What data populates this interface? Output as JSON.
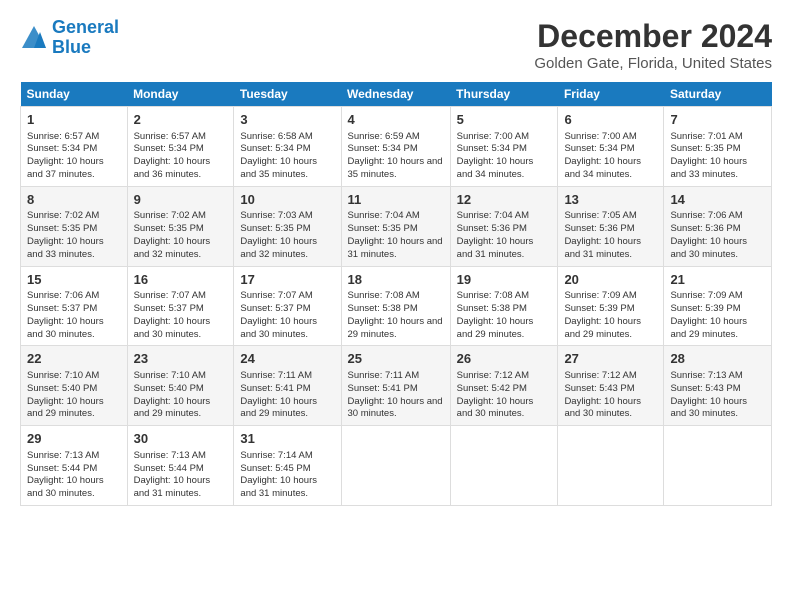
{
  "logo": {
    "line1": "General",
    "line2": "Blue"
  },
  "title": "December 2024",
  "subtitle": "Golden Gate, Florida, United States",
  "days_of_week": [
    "Sunday",
    "Monday",
    "Tuesday",
    "Wednesday",
    "Thursday",
    "Friday",
    "Saturday"
  ],
  "weeks": [
    [
      {
        "day": "1",
        "sunrise": "Sunrise: 6:57 AM",
        "sunset": "Sunset: 5:34 PM",
        "daylight": "Daylight: 10 hours and 37 minutes."
      },
      {
        "day": "2",
        "sunrise": "Sunrise: 6:57 AM",
        "sunset": "Sunset: 5:34 PM",
        "daylight": "Daylight: 10 hours and 36 minutes."
      },
      {
        "day": "3",
        "sunrise": "Sunrise: 6:58 AM",
        "sunset": "Sunset: 5:34 PM",
        "daylight": "Daylight: 10 hours and 35 minutes."
      },
      {
        "day": "4",
        "sunrise": "Sunrise: 6:59 AM",
        "sunset": "Sunset: 5:34 PM",
        "daylight": "Daylight: 10 hours and 35 minutes."
      },
      {
        "day": "5",
        "sunrise": "Sunrise: 7:00 AM",
        "sunset": "Sunset: 5:34 PM",
        "daylight": "Daylight: 10 hours and 34 minutes."
      },
      {
        "day": "6",
        "sunrise": "Sunrise: 7:00 AM",
        "sunset": "Sunset: 5:34 PM",
        "daylight": "Daylight: 10 hours and 34 minutes."
      },
      {
        "day": "7",
        "sunrise": "Sunrise: 7:01 AM",
        "sunset": "Sunset: 5:35 PM",
        "daylight": "Daylight: 10 hours and 33 minutes."
      }
    ],
    [
      {
        "day": "8",
        "sunrise": "Sunrise: 7:02 AM",
        "sunset": "Sunset: 5:35 PM",
        "daylight": "Daylight: 10 hours and 33 minutes."
      },
      {
        "day": "9",
        "sunrise": "Sunrise: 7:02 AM",
        "sunset": "Sunset: 5:35 PM",
        "daylight": "Daylight: 10 hours and 32 minutes."
      },
      {
        "day": "10",
        "sunrise": "Sunrise: 7:03 AM",
        "sunset": "Sunset: 5:35 PM",
        "daylight": "Daylight: 10 hours and 32 minutes."
      },
      {
        "day": "11",
        "sunrise": "Sunrise: 7:04 AM",
        "sunset": "Sunset: 5:35 PM",
        "daylight": "Daylight: 10 hours and 31 minutes."
      },
      {
        "day": "12",
        "sunrise": "Sunrise: 7:04 AM",
        "sunset": "Sunset: 5:36 PM",
        "daylight": "Daylight: 10 hours and 31 minutes."
      },
      {
        "day": "13",
        "sunrise": "Sunrise: 7:05 AM",
        "sunset": "Sunset: 5:36 PM",
        "daylight": "Daylight: 10 hours and 31 minutes."
      },
      {
        "day": "14",
        "sunrise": "Sunrise: 7:06 AM",
        "sunset": "Sunset: 5:36 PM",
        "daylight": "Daylight: 10 hours and 30 minutes."
      }
    ],
    [
      {
        "day": "15",
        "sunrise": "Sunrise: 7:06 AM",
        "sunset": "Sunset: 5:37 PM",
        "daylight": "Daylight: 10 hours and 30 minutes."
      },
      {
        "day": "16",
        "sunrise": "Sunrise: 7:07 AM",
        "sunset": "Sunset: 5:37 PM",
        "daylight": "Daylight: 10 hours and 30 minutes."
      },
      {
        "day": "17",
        "sunrise": "Sunrise: 7:07 AM",
        "sunset": "Sunset: 5:37 PM",
        "daylight": "Daylight: 10 hours and 30 minutes."
      },
      {
        "day": "18",
        "sunrise": "Sunrise: 7:08 AM",
        "sunset": "Sunset: 5:38 PM",
        "daylight": "Daylight: 10 hours and 29 minutes."
      },
      {
        "day": "19",
        "sunrise": "Sunrise: 7:08 AM",
        "sunset": "Sunset: 5:38 PM",
        "daylight": "Daylight: 10 hours and 29 minutes."
      },
      {
        "day": "20",
        "sunrise": "Sunrise: 7:09 AM",
        "sunset": "Sunset: 5:39 PM",
        "daylight": "Daylight: 10 hours and 29 minutes."
      },
      {
        "day": "21",
        "sunrise": "Sunrise: 7:09 AM",
        "sunset": "Sunset: 5:39 PM",
        "daylight": "Daylight: 10 hours and 29 minutes."
      }
    ],
    [
      {
        "day": "22",
        "sunrise": "Sunrise: 7:10 AM",
        "sunset": "Sunset: 5:40 PM",
        "daylight": "Daylight: 10 hours and 29 minutes."
      },
      {
        "day": "23",
        "sunrise": "Sunrise: 7:10 AM",
        "sunset": "Sunset: 5:40 PM",
        "daylight": "Daylight: 10 hours and 29 minutes."
      },
      {
        "day": "24",
        "sunrise": "Sunrise: 7:11 AM",
        "sunset": "Sunset: 5:41 PM",
        "daylight": "Daylight: 10 hours and 29 minutes."
      },
      {
        "day": "25",
        "sunrise": "Sunrise: 7:11 AM",
        "sunset": "Sunset: 5:41 PM",
        "daylight": "Daylight: 10 hours and 30 minutes."
      },
      {
        "day": "26",
        "sunrise": "Sunrise: 7:12 AM",
        "sunset": "Sunset: 5:42 PM",
        "daylight": "Daylight: 10 hours and 30 minutes."
      },
      {
        "day": "27",
        "sunrise": "Sunrise: 7:12 AM",
        "sunset": "Sunset: 5:43 PM",
        "daylight": "Daylight: 10 hours and 30 minutes."
      },
      {
        "day": "28",
        "sunrise": "Sunrise: 7:13 AM",
        "sunset": "Sunset: 5:43 PM",
        "daylight": "Daylight: 10 hours and 30 minutes."
      }
    ],
    [
      {
        "day": "29",
        "sunrise": "Sunrise: 7:13 AM",
        "sunset": "Sunset: 5:44 PM",
        "daylight": "Daylight: 10 hours and 30 minutes."
      },
      {
        "day": "30",
        "sunrise": "Sunrise: 7:13 AM",
        "sunset": "Sunset: 5:44 PM",
        "daylight": "Daylight: 10 hours and 31 minutes."
      },
      {
        "day": "31",
        "sunrise": "Sunrise: 7:14 AM",
        "sunset": "Sunset: 5:45 PM",
        "daylight": "Daylight: 10 hours and 31 minutes."
      },
      null,
      null,
      null,
      null
    ]
  ]
}
